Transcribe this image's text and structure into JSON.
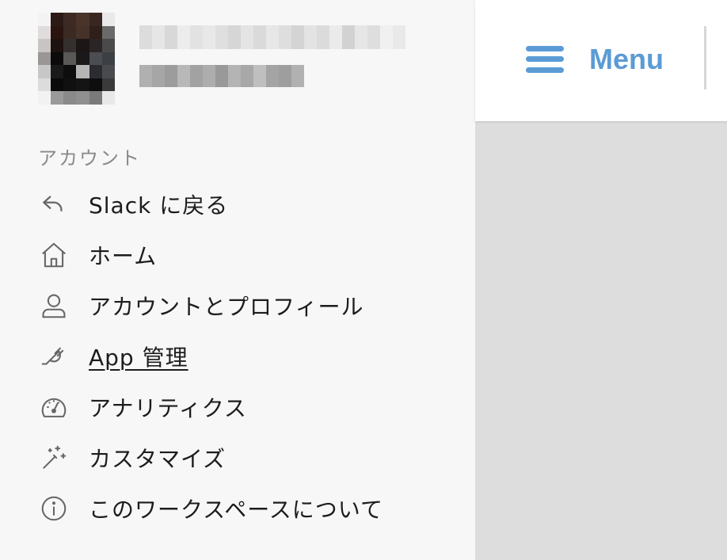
{
  "sidebar": {
    "section_label": "アカウント",
    "items": [
      {
        "label": "Slack に戻る",
        "icon": "back-arrow-icon"
      },
      {
        "label": "ホーム",
        "icon": "home-icon"
      },
      {
        "label": "アカウントとプロフィール",
        "icon": "user-icon"
      },
      {
        "label": "App 管理",
        "icon": "plug-icon"
      },
      {
        "label": "アナリティクス",
        "icon": "gauge-icon"
      },
      {
        "label": "カスタマイズ",
        "icon": "magic-wand-icon"
      },
      {
        "label": "このワークスペースについて",
        "icon": "info-icon"
      }
    ]
  },
  "topbar": {
    "menu_label": "Menu",
    "menu_icon": "hamburger-icon"
  },
  "colors": {
    "accent": "#5b9bd5",
    "sidebar_bg": "#f7f7f7",
    "content_bg": "#dddddd",
    "text": "#1d1c1d",
    "muted": "#8a8a8a"
  }
}
